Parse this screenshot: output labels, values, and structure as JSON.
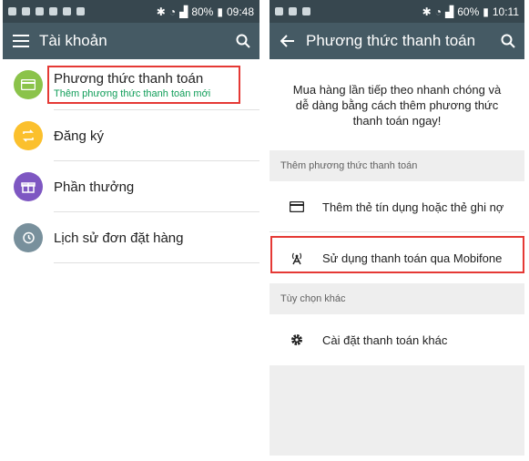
{
  "left": {
    "status": {
      "icons": [
        "messaging-icon",
        "chat-icon",
        "missed-call-icon",
        "gallery-icon",
        "sync-icon",
        "mail-icon"
      ],
      "battery": "80%",
      "time": "09:48"
    },
    "appbar": {
      "title": "Tài khoản"
    },
    "items": [
      {
        "label": "Phương thức thanh toán",
        "sub": "Thêm phương thức thanh toán mới",
        "color": "#8bc34a",
        "icon": "card-icon"
      },
      {
        "label": "Đăng ký",
        "color": "#fbc02d",
        "icon": "repeat-icon"
      },
      {
        "label": "Phần thưởng",
        "color": "#7e57c2",
        "icon": "gift-icon"
      },
      {
        "label": "Lịch sử đơn đặt hàng",
        "color": "#78909c",
        "icon": "history-icon"
      }
    ]
  },
  "right": {
    "status": {
      "icons": [
        "mail-icon",
        "missed-call-icon",
        "settings-sync-icon"
      ],
      "battery": "60%",
      "time": "10:11"
    },
    "appbar": {
      "title": "Phương thức thanh toán"
    },
    "promo": "Mua hàng lần tiếp theo nhanh chóng và dễ dàng bằng cách thêm phương thức thanh toán ngay!",
    "section1": "Thêm phương thức thanh toán",
    "add_card": "Thêm thẻ tín dụng hoặc thẻ ghi nợ",
    "carrier": "Sử dụng thanh toán qua Mobifone",
    "section2": "Tùy chọn khác",
    "other_settings": "Cài đặt thanh toán khác"
  },
  "colors": {
    "statusbar": "#37474f",
    "appbar": "#455a64",
    "highlight": "#e53935",
    "subtitle": "#0f9d58"
  }
}
